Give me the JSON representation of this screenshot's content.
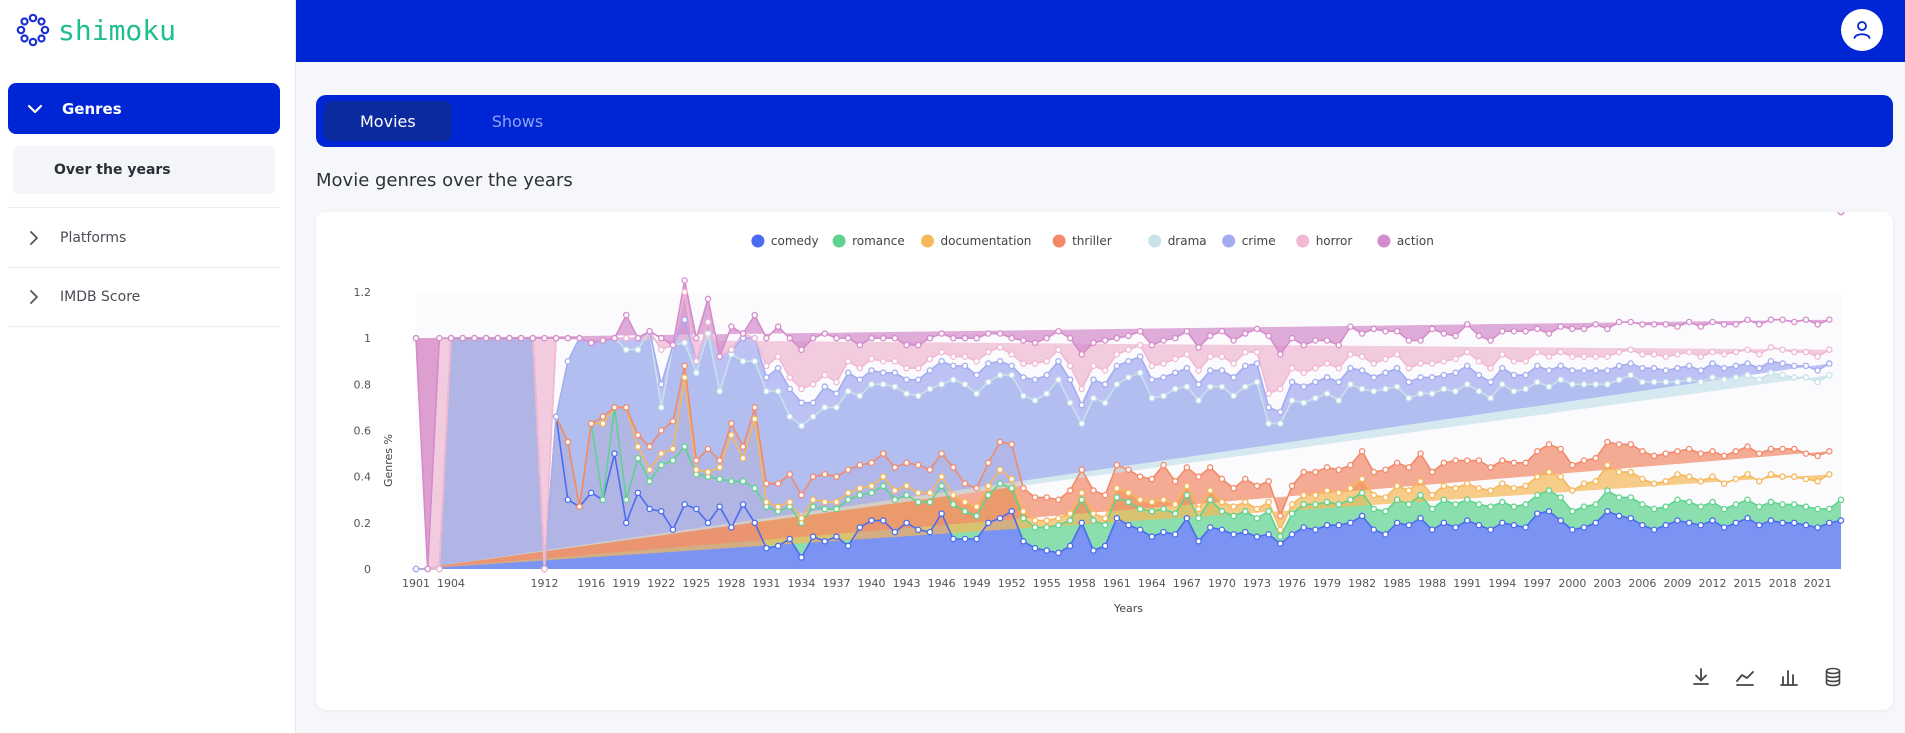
{
  "app": {
    "logo_text": "shimoku"
  },
  "sidebar": {
    "group": {
      "label": "Genres",
      "expanded": true
    },
    "sub_item": {
      "label": "Over the years"
    },
    "items": [
      {
        "label": "Platforms"
      },
      {
        "label": "IMDB Score"
      }
    ]
  },
  "tabs": [
    {
      "label": "Movies",
      "active": true
    },
    {
      "label": "Shows",
      "active": false
    }
  ],
  "page": {
    "title": "Movie genres over the years"
  },
  "toolbar": {
    "icons": [
      "download-icon",
      "line-chart-icon",
      "bar-chart-icon",
      "database-icon"
    ]
  },
  "colors": {
    "brand": "#0025d4",
    "logo": "#1fbf8f"
  },
  "chart_data": {
    "type": "area",
    "stacked": true,
    "x": [
      "1901",
      "1902",
      "1903",
      "1904",
      "1905",
      "1906",
      "1907",
      "1908",
      "1909",
      "1910",
      "1911",
      "1912",
      "1913",
      "1914",
      "1915",
      "1916",
      "1917",
      "1918",
      "1919",
      "1920",
      "1921",
      "1922",
      "1923",
      "1924",
      "1925",
      "1926",
      "1927",
      "1928",
      "1929",
      "1930",
      "1931",
      "1932",
      "1933",
      "1934",
      "1935",
      "1936",
      "1937",
      "1938",
      "1939",
      "1940",
      "1941",
      "1942",
      "1943",
      "1944",
      "1945",
      "1946",
      "1947",
      "1948",
      "1949",
      "1950",
      "1951",
      "1952",
      "1953",
      "1954",
      "1955",
      "1956",
      "1957",
      "1958",
      "1959",
      "1960",
      "1961",
      "1962",
      "1963",
      "1964",
      "1965",
      "1966",
      "1967",
      "1968",
      "1969",
      "1970",
      "1971",
      "1972",
      "1973",
      "1974",
      "1975",
      "1976",
      "1977",
      "1978",
      "1979",
      "1980",
      "1981",
      "1982",
      "1983",
      "1984",
      "1985",
      "1986",
      "1987",
      "1988",
      "1989",
      "1990",
      "1991",
      "1992",
      "1993",
      "1994",
      "1995",
      "1996",
      "1997",
      "1998",
      "1999",
      "2000",
      "2001",
      "2002",
      "2003",
      "2004",
      "2005",
      "2006",
      "2007",
      "2008",
      "2009",
      "2010",
      "2011",
      "2012",
      "2013",
      "2014",
      "2015",
      "2016",
      "2017",
      "2018",
      "2019",
      "2020",
      "2021",
      "2022",
      "2023"
    ],
    "x_tick_labels": [
      "1901",
      "1904",
      "1912",
      "1916",
      "1919",
      "1922",
      "1925",
      "1928",
      "1931",
      "1934",
      "1937",
      "1940",
      "1943",
      "1946",
      "1949",
      "1952",
      "1955",
      "1958",
      "1961",
      "1964",
      "1967",
      "1970",
      "1973",
      "1976",
      "1979",
      "1982",
      "1985",
      "1988",
      "1991",
      "1994",
      "1997",
      "2000",
      "2003",
      "2006",
      "2009",
      "2012",
      "2015",
      "2018",
      "2021"
    ],
    "y_ticks": [
      0,
      0.2,
      0.4,
      0.6,
      0.8,
      1,
      1.2
    ],
    "ylim": [
      0,
      1.2
    ],
    "xlabel": "Years",
    "ylabel": "Genres %",
    "legend_position": "top-center",
    "grid": false,
    "series": [
      {
        "name": "comedy",
        "color": "#4a6cf0",
        "values": [
          0,
          0,
          0,
          1,
          1,
          1,
          1,
          1,
          1,
          1,
          1,
          0,
          0.66,
          0.3,
          0.27,
          0.33,
          0.3,
          0.5,
          0.2,
          0.33,
          0.26,
          0.25,
          0.17,
          0.28,
          0.26,
          0.2,
          0.27,
          0.18,
          0.28,
          0.2,
          0.09,
          0.1,
          0.13,
          0.05,
          0.14,
          0.12,
          0.14,
          0.1,
          0.18,
          0.21,
          0.21,
          0.16,
          0.2,
          0.17,
          0.16,
          0.24,
          0.13,
          0.13,
          0.13,
          0.2,
          0.22,
          0.25,
          0.12,
          0.09,
          0.08,
          0.07,
          0.1,
          0.2,
          0.08,
          0.1,
          0.22,
          0.19,
          0.17,
          0.14,
          0.16,
          0.15,
          0.22,
          0.12,
          0.18,
          0.17,
          0.15,
          0.16,
          0.14,
          0.15,
          0.11,
          0.15,
          0.18,
          0.17,
          0.19,
          0.19,
          0.2,
          0.23,
          0.17,
          0.15,
          0.2,
          0.19,
          0.22,
          0.17,
          0.2,
          0.18,
          0.21,
          0.19,
          0.17,
          0.2,
          0.19,
          0.18,
          0.24,
          0.25,
          0.21,
          0.17,
          0.18,
          0.2,
          0.25,
          0.23,
          0.22,
          0.19,
          0.17,
          0.19,
          0.21,
          0.2,
          0.19,
          0.21,
          0.18,
          0.2,
          0.22,
          0.19,
          0.21,
          0.2,
          0.2,
          0.19,
          0.18,
          0.2,
          0.21
        ]
      },
      {
        "name": "romance",
        "color": "#5fd38d",
        "values": [
          0,
          0,
          0,
          0,
          0,
          0,
          0,
          0,
          0,
          0,
          0,
          0,
          0,
          0.25,
          0,
          0.3,
          0,
          0.2,
          0.1,
          0.15,
          0.12,
          0.2,
          0.3,
          0.25,
          0.15,
          0.2,
          0.12,
          0.2,
          0.1,
          0.15,
          0.18,
          0.15,
          0.14,
          0.15,
          0.13,
          0.14,
          0.12,
          0.2,
          0.14,
          0.12,
          0.15,
          0.14,
          0.12,
          0.12,
          0.13,
          0.12,
          0.15,
          0.12,
          0.1,
          0.12,
          0.15,
          0.1,
          0.1,
          0.09,
          0.1,
          0.12,
          0.11,
          0.1,
          0.13,
          0.09,
          0.09,
          0.1,
          0.09,
          0.11,
          0.1,
          0.09,
          0.1,
          0.1,
          0.12,
          0.08,
          0.08,
          0.09,
          0.08,
          0.1,
          0.03,
          0.09,
          0.1,
          0.11,
          0.1,
          0.09,
          0.1,
          0.1,
          0.09,
          0.1,
          0.1,
          0.09,
          0.1,
          0.09,
          0.1,
          0.1,
          0.09,
          0.09,
          0.1,
          0.09,
          0.08,
          0.1,
          0.08,
          0.09,
          0.1,
          0.08,
          0.09,
          0.08,
          0.09,
          0.08,
          0.09,
          0.09,
          0.09,
          0.08,
          0.09,
          0.09,
          0.08,
          0.08,
          0.08,
          0.08,
          0.08,
          0.08,
          0.08,
          0.08,
          0.08,
          0.08,
          0.08,
          0.06,
          0.09
        ]
      },
      {
        "name": "documentation",
        "color": "#f5b85a",
        "values": [
          0,
          0,
          0,
          0,
          0,
          0,
          0,
          0,
          0,
          0,
          0,
          0,
          0,
          0,
          0,
          0,
          0.33,
          0,
          0.4,
          0.05,
          0.05,
          0.05,
          0.05,
          0.3,
          0.02,
          0.02,
          0.05,
          0.2,
          0.1,
          0.3,
          0.02,
          0.02,
          0.02,
          0.02,
          0.03,
          0.03,
          0.03,
          0.03,
          0.03,
          0.03,
          0.04,
          0.04,
          0.04,
          0.04,
          0.04,
          0.04,
          0.04,
          0.04,
          0.04,
          0.04,
          0.06,
          0.04,
          0.03,
          0.03,
          0.03,
          0.03,
          0.03,
          0.03,
          0.03,
          0.03,
          0.04,
          0.04,
          0.04,
          0.04,
          0.04,
          0.04,
          0.04,
          0.04,
          0.04,
          0.04,
          0.04,
          0.04,
          0.04,
          0.04,
          0.03,
          0.04,
          0.04,
          0.04,
          0.05,
          0.05,
          0.05,
          0.06,
          0.06,
          0.06,
          0.06,
          0.06,
          0.06,
          0.06,
          0.06,
          0.07,
          0.07,
          0.07,
          0.07,
          0.08,
          0.08,
          0.08,
          0.08,
          0.08,
          0.09,
          0.09,
          0.1,
          0.1,
          0.11,
          0.11,
          0.11,
          0.11,
          0.11,
          0.11,
          0.11,
          0.11,
          0.11,
          0.11,
          0.11,
          0.11,
          0.11,
          0.11,
          0.12,
          0.12,
          0.12,
          0.12,
          0.12,
          0.15
        ]
      },
      {
        "name": "thriller",
        "color": "#f28a6a",
        "values": [
          0,
          0,
          0,
          0,
          0,
          0,
          0,
          0,
          0,
          0,
          0,
          0,
          0,
          0,
          0,
          0,
          0.03,
          0,
          0,
          0.05,
          0.1,
          0.1,
          0.12,
          0.05,
          0.04,
          0.1,
          0.03,
          0.05,
          0.05,
          0.05,
          0.08,
          0.1,
          0.12,
          0.1,
          0.1,
          0.12,
          0.11,
          0.1,
          0.1,
          0.1,
          0.1,
          0.1,
          0.1,
          0.12,
          0.1,
          0.1,
          0.12,
          0.08,
          0.08,
          0.1,
          0.12,
          0.15,
          0.1,
          0.1,
          0.1,
          0.08,
          0.1,
          0.1,
          0.1,
          0.1,
          0.1,
          0.1,
          0.1,
          0.1,
          0.15,
          0.1,
          0.08,
          0.14,
          0.1,
          0.1,
          0.08,
          0.1,
          0.1,
          0.09,
          0.06,
          0.08,
          0.1,
          0.1,
          0.1,
          0.1,
          0.1,
          0.12,
          0.1,
          0.12,
          0.1,
          0.1,
          0.12,
          0.1,
          0.1,
          0.12,
          0.1,
          0.12,
          0.1,
          0.1,
          0.11,
          0.1,
          0.11,
          0.12,
          0.12,
          0.11,
          0.1,
          0.1,
          0.1,
          0.12,
          0.12,
          0.12,
          0.12,
          0.12,
          0.1,
          0.12,
          0.12,
          0.11,
          0.12,
          0.12,
          0.12,
          0.12,
          0.11,
          0.12,
          0.12,
          0.11,
          0.11,
          0.1,
          0.13
        ]
      },
      {
        "name": "drama",
        "color": "#c9e2ea",
        "values": [
          0,
          0,
          0,
          0,
          0,
          0,
          0,
          0,
          0,
          0,
          0,
          0,
          0,
          0.35,
          0.73,
          0.35,
          0.33,
          0.3,
          0.25,
          0.37,
          0.5,
          0.1,
          0.33,
          0.1,
          0.38,
          0.5,
          0.3,
          0.3,
          0.37,
          0.2,
          0.4,
          0.4,
          0.25,
          0.3,
          0.26,
          0.29,
          0.3,
          0.34,
          0.3,
          0.34,
          0.3,
          0.35,
          0.3,
          0.3,
          0.35,
          0.3,
          0.38,
          0.43,
          0.41,
          0.35,
          0.29,
          0.3,
          0.4,
          0.42,
          0.45,
          0.52,
          0.38,
          0.2,
          0.4,
          0.4,
          0.35,
          0.4,
          0.45,
          0.35,
          0.3,
          0.4,
          0.35,
          0.33,
          0.35,
          0.4,
          0.4,
          0.4,
          0.45,
          0.25,
          0.4,
          0.37,
          0.3,
          0.32,
          0.32,
          0.3,
          0.35,
          0.27,
          0.35,
          0.35,
          0.33,
          0.3,
          0.26,
          0.34,
          0.32,
          0.3,
          0.33,
          0.3,
          0.3,
          0.33,
          0.31,
          0.32,
          0.3,
          0.25,
          0.3,
          0.35,
          0.33,
          0.32,
          0.25,
          0.28,
          0.3,
          0.3,
          0.32,
          0.31,
          0.3,
          0.3,
          0.31,
          0.32,
          0.33,
          0.32,
          0.31,
          0.32,
          0.33,
          0.32,
          0.31,
          0.33,
          0.32,
          0.33,
          0.23
        ]
      },
      {
        "name": "crime",
        "color": "#a3acf0",
        "values": [
          0,
          0,
          0,
          0,
          0,
          0,
          0,
          0,
          0,
          0,
          0,
          0,
          0,
          0,
          0,
          0,
          0,
          0,
          0.05,
          0.05,
          0,
          0.1,
          0,
          0.1,
          0.05,
          0.05,
          0.15,
          0.02,
          0.1,
          0.1,
          0.06,
          0.1,
          0.12,
          0.1,
          0.06,
          0.09,
          0.06,
          0.08,
          0.07,
          0.06,
          0.05,
          0.06,
          0.06,
          0.07,
          0.08,
          0.1,
          0.06,
          0.08,
          0.08,
          0.08,
          0.06,
          0.04,
          0.08,
          0.09,
          0.08,
          0.08,
          0.1,
          0.08,
          0.08,
          0.08,
          0.08,
          0.07,
          0.07,
          0.08,
          0.08,
          0.07,
          0.08,
          0.07,
          0.07,
          0.07,
          0.08,
          0.09,
          0.08,
          0.07,
          0.05,
          0.08,
          0.07,
          0.07,
          0.07,
          0.08,
          0.07,
          0.08,
          0.06,
          0.07,
          0.08,
          0.07,
          0.07,
          0.07,
          0.06,
          0.08,
          0.08,
          0.07,
          0.07,
          0.07,
          0.07,
          0.06,
          0.07,
          0.07,
          0.06,
          0.06,
          0.06,
          0.06,
          0.06,
          0.06,
          0.05,
          0.06,
          0.06,
          0.05,
          0.06,
          0.06,
          0.05,
          0.06,
          0.05,
          0.05,
          0.05,
          0.05,
          0.05,
          0.05,
          0.05,
          0.05,
          0.05,
          0.05,
          0.07
        ]
      },
      {
        "name": "horror",
        "color": "#f0b8d2",
        "values": [
          1,
          0,
          0,
          0,
          0,
          0,
          0,
          0,
          0,
          0,
          0,
          0,
          0.34,
          0.1,
          0,
          0,
          0,
          0,
          0,
          0,
          0,
          0.15,
          0,
          0.12,
          0,
          0,
          0,
          0,
          0.02,
          0,
          0.05,
          0.05,
          0.05,
          0.06,
          0.08,
          0.05,
          0.05,
          0.05,
          0.05,
          0.05,
          0.05,
          0.05,
          0.05,
          0.05,
          0.05,
          0.04,
          0.04,
          0.04,
          0.06,
          0.05,
          0.06,
          0.05,
          0.06,
          0.07,
          0.06,
          0.05,
          0.06,
          0.07,
          0.06,
          0.06,
          0.05,
          0.05,
          0.05,
          0.06,
          0.06,
          0.06,
          0.06,
          0.06,
          0.06,
          0.06,
          0.06,
          0.06,
          0.05,
          0.06,
          0.1,
          0.06,
          0.06,
          0.06,
          0.06,
          0.06,
          0.06,
          0.06,
          0.06,
          0.06,
          0.06,
          0.06,
          0.06,
          0.06,
          0.06,
          0.06,
          0.06,
          0.06,
          0.06,
          0.06,
          0.06,
          0.06,
          0.06,
          0.06,
          0.06,
          0.06,
          0.06,
          0.06,
          0.06,
          0.06,
          0.06,
          0.06,
          0.06,
          0.06,
          0.06,
          0.06,
          0.06,
          0.05,
          0.06,
          0.06,
          0.06,
          0.06,
          0.06,
          0.06,
          0.06,
          0.06,
          0.06,
          0.06,
          0.06
        ]
      },
      {
        "name": "action",
        "color": "#d48cca",
        "values": [
          0,
          0,
          1,
          0,
          0,
          0,
          0,
          0,
          0,
          0,
          0,
          1,
          0,
          0,
          0,
          0,
          0,
          0,
          0.1,
          0,
          0,
          0.05,
          0,
          0.05,
          0.1,
          0.1,
          0,
          0.1,
          0,
          0.1,
          0.12,
          0.13,
          0.17,
          0.17,
          0.2,
          0.18,
          0.19,
          0.1,
          0.1,
          0.09,
          0.1,
          0.1,
          0.1,
          0.1,
          0.09,
          0.08,
          0.08,
          0.08,
          0.1,
          0.08,
          0.06,
          0.07,
          0.1,
          0.09,
          0.1,
          0.08,
          0.12,
          0.15,
          0.1,
          0.13,
          0.07,
          0.06,
          0.06,
          0.09,
          0.1,
          0.09,
          0.1,
          0.1,
          0.09,
          0.11,
          0.1,
          0.08,
          0.1,
          0.25,
          0.15,
          0.13,
          0.12,
          0.12,
          0.1,
          0.1,
          0.12,
          0.1,
          0.15,
          0.12,
          0.1,
          0.12,
          0.1,
          0.15,
          0.12,
          0.1,
          0.12,
          0.11,
          0.12,
          0.1,
          0.13,
          0.13,
          0.1,
          0.1,
          0.11,
          0.12,
          0.12,
          0.14,
          0.12,
          0.13,
          0.12,
          0.13,
          0.13,
          0.14,
          0.12,
          0.13,
          0.13,
          0.13,
          0.13,
          0.12,
          0.13,
          0.13,
          0.12,
          0.13,
          0.13,
          0.14,
          0.14,
          0.13,
          0.07
        ]
      }
    ]
  }
}
